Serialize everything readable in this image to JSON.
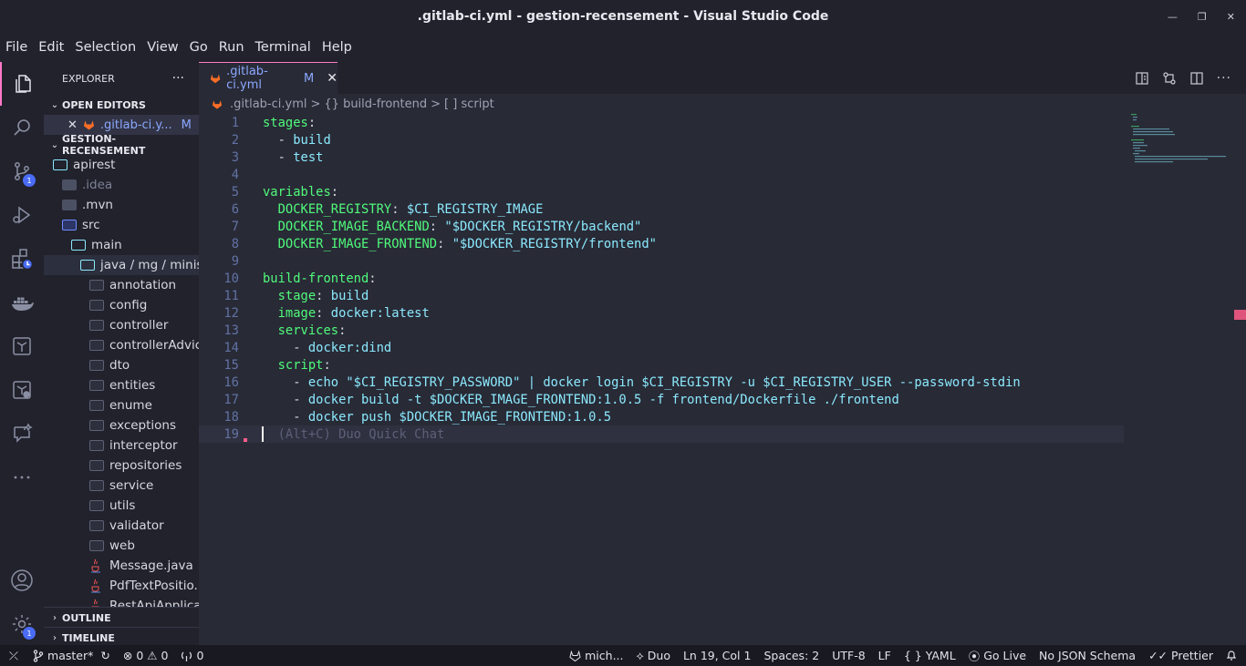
{
  "window": {
    "title": ".gitlab-ci.yml - gestion-recensement - Visual Studio Code",
    "controls": {
      "minimize": "—",
      "restore": "❐",
      "close": "✕"
    }
  },
  "menu": [
    "File",
    "Edit",
    "Selection",
    "View",
    "Go",
    "Run",
    "Terminal",
    "Help"
  ],
  "activity_bar": {
    "items": [
      {
        "icon": "files-icon",
        "active": true
      },
      {
        "icon": "search-icon"
      },
      {
        "icon": "source-control-icon",
        "badge": "1"
      },
      {
        "icon": "run-debug-icon"
      },
      {
        "icon": "extensions-icon"
      },
      {
        "icon": "docker-icon"
      },
      {
        "icon": "terraform-icon"
      },
      {
        "icon": "remote-icon"
      },
      {
        "icon": "chat-icon"
      },
      {
        "icon": "more-icon"
      }
    ],
    "bottom": [
      {
        "icon": "account-icon"
      },
      {
        "icon": "settings-gear-icon",
        "badge": "1"
      }
    ]
  },
  "sidebar": {
    "title": "EXPLORER",
    "more": "···",
    "open_editors": {
      "header": "OPEN EDITORS",
      "file": ".gitlab-ci.y...",
      "status": "M",
      "close": "✕"
    },
    "project": {
      "header": "GESTION-RECENSEMENT",
      "items": [
        {
          "label": "apirest",
          "type": "folder-open",
          "indent": 1
        },
        {
          "label": ".idea",
          "type": "folder-filled",
          "indent": 2,
          "dim": true
        },
        {
          "label": ".mvn",
          "type": "folder-filled",
          "indent": 2
        },
        {
          "label": "src",
          "type": "folder-src",
          "indent": 2
        },
        {
          "label": "main",
          "type": "folder-open",
          "indent": 3
        },
        {
          "label": "java / mg / minist...",
          "type": "folder-open",
          "indent": 4,
          "selected": true
        },
        {
          "label": "annotation",
          "type": "folder",
          "indent": 5
        },
        {
          "label": "config",
          "type": "folder",
          "indent": 5
        },
        {
          "label": "controller",
          "type": "folder",
          "indent": 5
        },
        {
          "label": "controllerAdvice",
          "type": "folder",
          "indent": 5
        },
        {
          "label": "dto",
          "type": "folder",
          "indent": 5
        },
        {
          "label": "entities",
          "type": "folder",
          "indent": 5
        },
        {
          "label": "enume",
          "type": "folder",
          "indent": 5
        },
        {
          "label": "exceptions",
          "type": "folder",
          "indent": 5
        },
        {
          "label": "interceptor",
          "type": "folder",
          "indent": 5
        },
        {
          "label": "repositories",
          "type": "folder",
          "indent": 5
        },
        {
          "label": "service",
          "type": "folder",
          "indent": 5
        },
        {
          "label": "utils",
          "type": "folder",
          "indent": 5
        },
        {
          "label": "validator",
          "type": "folder",
          "indent": 5
        },
        {
          "label": "web",
          "type": "folder",
          "indent": 5
        },
        {
          "label": "Message.java",
          "type": "java",
          "indent": 5
        },
        {
          "label": "PdfTextPositio...",
          "type": "java",
          "indent": 5
        },
        {
          "label": "RestApiApplica...",
          "type": "java",
          "indent": 5
        }
      ]
    },
    "outline": "OUTLINE",
    "timeline": "TIMELINE"
  },
  "editor": {
    "tab": {
      "label": ".gitlab-ci.yml",
      "status": "M",
      "close": "✕"
    },
    "breadcrumb": [
      ".gitlab-ci.yml",
      "{} build-frontend",
      "[ ] script"
    ],
    "breadcrumb_sep": ">",
    "lines": [
      [
        {
          "t": "stages",
          "c": "k"
        },
        {
          "t": ":",
          "c": "p"
        }
      ],
      [
        {
          "t": "  - ",
          "c": "p"
        },
        {
          "t": "build",
          "c": "v"
        }
      ],
      [
        {
          "t": "  - ",
          "c": "p"
        },
        {
          "t": "test",
          "c": "v"
        }
      ],
      [],
      [
        {
          "t": "variables",
          "c": "k"
        },
        {
          "t": ":",
          "c": "p"
        }
      ],
      [
        {
          "t": "  ",
          "c": "p"
        },
        {
          "t": "DOCKER_REGISTRY",
          "c": "k"
        },
        {
          "t": ": ",
          "c": "p"
        },
        {
          "t": "$CI_REGISTRY_IMAGE",
          "c": "v"
        }
      ],
      [
        {
          "t": "  ",
          "c": "p"
        },
        {
          "t": "DOCKER_IMAGE_BACKEND",
          "c": "k"
        },
        {
          "t": ": ",
          "c": "p"
        },
        {
          "t": "\"$DOCKER_REGISTRY/backend\"",
          "c": "s"
        }
      ],
      [
        {
          "t": "  ",
          "c": "p"
        },
        {
          "t": "DOCKER_IMAGE_FRONTEND",
          "c": "k"
        },
        {
          "t": ": ",
          "c": "p"
        },
        {
          "t": "\"$DOCKER_REGISTRY/frontend\"",
          "c": "s"
        }
      ],
      [],
      [
        {
          "t": "build-frontend",
          "c": "k"
        },
        {
          "t": ":",
          "c": "p"
        }
      ],
      [
        {
          "t": "  ",
          "c": "p"
        },
        {
          "t": "stage",
          "c": "k"
        },
        {
          "t": ": ",
          "c": "p"
        },
        {
          "t": "build",
          "c": "v"
        }
      ],
      [
        {
          "t": "  ",
          "c": "p"
        },
        {
          "t": "image",
          "c": "k"
        },
        {
          "t": ": ",
          "c": "p"
        },
        {
          "t": "docker:latest",
          "c": "v"
        }
      ],
      [
        {
          "t": "  ",
          "c": "p"
        },
        {
          "t": "services",
          "c": "k"
        },
        {
          "t": ":",
          "c": "p"
        }
      ],
      [
        {
          "t": "    - ",
          "c": "p"
        },
        {
          "t": "docker:dind",
          "c": "v"
        }
      ],
      [
        {
          "t": "  ",
          "c": "p"
        },
        {
          "t": "script",
          "c": "k"
        },
        {
          "t": ":",
          "c": "p"
        }
      ],
      [
        {
          "t": "    - ",
          "c": "p"
        },
        {
          "t": "echo \"$CI_REGISTRY_PASSWORD\" | docker login $CI_REGISTRY -u $CI_REGISTRY_USER --password-stdin",
          "c": "v"
        }
      ],
      [
        {
          "t": "    - ",
          "c": "p"
        },
        {
          "t": "docker build -t $DOCKER_IMAGE_FRONTEND:1.0.5 -f frontend/Dockerfile ./frontend",
          "c": "v"
        }
      ],
      [
        {
          "t": "    - ",
          "c": "p"
        },
        {
          "t": "docker push $DOCKER_IMAGE_FRONTEND:1.0.5",
          "c": "v"
        }
      ],
      [
        {
          "t": "  (Alt+C) Duo Quick Chat",
          "c": "ghost"
        }
      ]
    ],
    "current_line": 19
  },
  "status_bar": {
    "remote": "⤫",
    "branch": "master*",
    "sync": "↻",
    "errors": "0",
    "warnings": "0",
    "ports": "0",
    "right": [
      "mich...",
      "Duo",
      "Ln 19, Col 1",
      "Spaces: 2",
      "UTF-8",
      "LF",
      "YAML",
      "Go Live",
      "No JSON Schema",
      "Prettier"
    ],
    "colors": {
      "background": "#191a21",
      "accent": "#ff79c6"
    }
  }
}
